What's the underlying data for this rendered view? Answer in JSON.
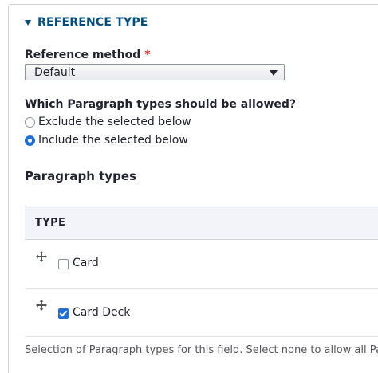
{
  "details": {
    "summary_label": "REFERENCE TYPE"
  },
  "reference_method": {
    "label": "Reference method",
    "required_marker": "*",
    "selected_value": "Default"
  },
  "allowed_types": {
    "question": "Which Paragraph types should be allowed?",
    "options": [
      {
        "label": "Exclude the selected below",
        "selected": false
      },
      {
        "label": "Include the selected below",
        "selected": true
      }
    ]
  },
  "paragraph_types": {
    "title": "Paragraph types",
    "column_header": "TYPE",
    "rows": [
      {
        "label": "Card",
        "checked": false
      },
      {
        "label": "Card Deck",
        "checked": true
      }
    ],
    "description": "Selection of Paragraph types for this field. Select none to allow all Par"
  },
  "colors": {
    "link_blue": "#004f80",
    "accent_blue": "#1f6fd6",
    "required_red": "#dc2323"
  }
}
